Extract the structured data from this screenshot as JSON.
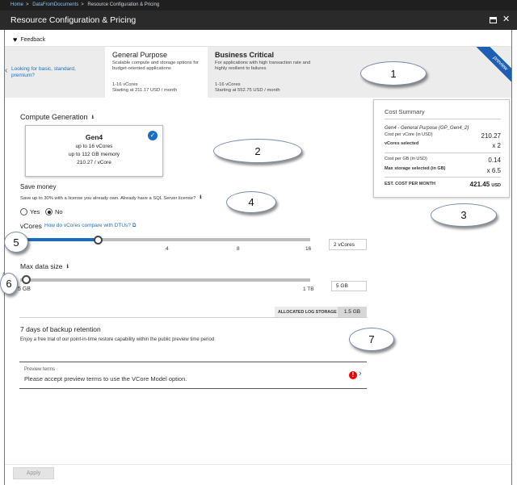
{
  "breadcrumb": [
    "Home",
    "DataFromDocuments",
    "Resource Configuration & Pricing"
  ],
  "window": {
    "title": "Resource Configuration & Pricing"
  },
  "feedback": "Feedback",
  "tiers": {
    "look_for": "Looking for basic, standard, premium?",
    "general_purpose": {
      "name": "General Purpose",
      "desc": "Scalable compute and storage options for budget-oriented applications",
      "vcores": "1-16 vCores",
      "price": "Starting at 211.17 USD / month"
    },
    "business_critical": {
      "name": "Business Critical",
      "desc": "For applications with high transaction rate and highly resilient to failures",
      "vcores": "1-16 vCores",
      "price": "Starting at 552.75 USD / month"
    },
    "ribbon": "preview"
  },
  "compute": {
    "label": "Compute Generation",
    "card": {
      "name": "Gen4",
      "vcores": "up to 16 vCores",
      "memory": "up to 112 GB memory",
      "price": "210.27 / vCore"
    }
  },
  "cost_summary": {
    "title": "Cost Summary",
    "config": "Gen4 - General Purpose (GP_Gen4_2)",
    "cost_per_vcore_label": "Cost per vCore (in USD)",
    "cost_per_vcore": "210.27",
    "vcores_selected_label": "vCores selected",
    "vcores_selected": "x 2",
    "cost_per_gb_label": "Cost per GB (in USD)",
    "cost_per_gb": "0.14",
    "max_storage_label": "Max storage selected (in GB)",
    "max_storage": "x 6.5",
    "est_label": "EST. COST PER MONTH",
    "est_value": "421.45",
    "est_unit": "USD"
  },
  "save_money": {
    "label": "Save money",
    "desc": "Save up to 30% with a license you already own. Already have a SQL Server license?",
    "yes": "Yes",
    "no": "No",
    "selected": "No"
  },
  "vcores": {
    "label": "vCores",
    "link": "How do vCores compare with DTUs?",
    "ticks": [
      "4",
      "8",
      "16"
    ],
    "value": "2 vCores",
    "level_fraction": 0.27
  },
  "max_data": {
    "label": "Max data size",
    "min_label": "5 GB",
    "max_label": "1 TB",
    "value": "5 GB",
    "level_fraction": 0.0
  },
  "log_storage": {
    "label": "ALLOCATED LOG STORAGE",
    "value": "1.5 GB"
  },
  "backup": {
    "title": "7 days of backup retention",
    "desc": "Enjoy a free trial of our point-in-time restore capability within the public preview time period"
  },
  "preview_terms": {
    "title": "Preview terms",
    "message": "Please accept preview terms to use the VCore Model option."
  },
  "apply": "Apply",
  "callouts": [
    "1",
    "2",
    "3",
    "4",
    "5",
    "6",
    "7"
  ]
}
